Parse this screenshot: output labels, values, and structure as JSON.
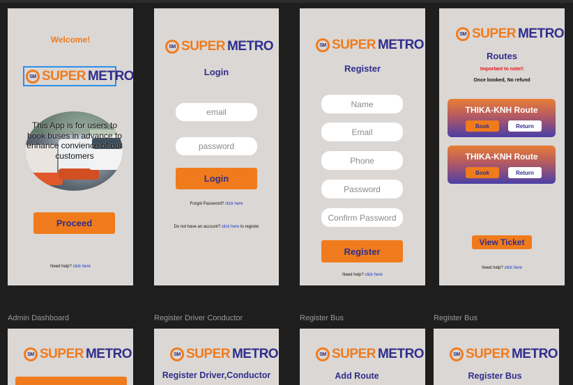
{
  "logo": {
    "word1": "SUPER",
    "word2": "METRO",
    "badge": "SM"
  },
  "frame1": {
    "welcome": "Welcome!",
    "description": "This App is for users to book buses in advance to enhance convience of our customers",
    "proceed": "Proceed",
    "help_text": "Need help?",
    "help_link": "click here"
  },
  "frame2": {
    "title": "Login",
    "email_placeholder": "email",
    "password_placeholder": "password",
    "login_button": "Login",
    "forgot_text": "Forgot Password?",
    "forgot_link": "click here",
    "noaccount_text": "Do not have an account?",
    "noaccount_link": "click here",
    "noaccount_suffix": "to register"
  },
  "frame3": {
    "title": "Register",
    "name_placeholder": "Name",
    "email_placeholder": "Email",
    "phone_placeholder": "Phone",
    "password_placeholder": "Password",
    "confirm_placeholder": "Confirm Password",
    "register_button": "Register",
    "help_text": "Need help?",
    "help_link": "click here"
  },
  "frame4": {
    "title": "Routes",
    "important": "Important to note!!",
    "note": "Once booked, No refund",
    "routes": [
      {
        "name": "THIKA-KNH Route",
        "book": "Book",
        "return": "Return"
      },
      {
        "name": "THIKA-KNH Route",
        "book": "Book",
        "return": "Return"
      }
    ],
    "view_ticket": "View Ticket",
    "help_text": "Need help?",
    "help_link": "click here"
  },
  "bottom_labels": {
    "admin": "Admin Dashboard",
    "driver": "Register Driver Conductor",
    "bus1": "Register Bus",
    "bus2": "Register Bus"
  },
  "frame5": {},
  "frame6": {
    "title": "Register Driver,Conductor"
  },
  "frame7": {
    "title": "Add Route"
  },
  "frame8": {
    "title": "Register Bus"
  },
  "colors": {
    "orange": "#f07b1d",
    "navy": "#2f2e8c",
    "frame_bg": "#dbd7d4",
    "canvas": "#1e1e1e",
    "link": "#1a35c8"
  }
}
